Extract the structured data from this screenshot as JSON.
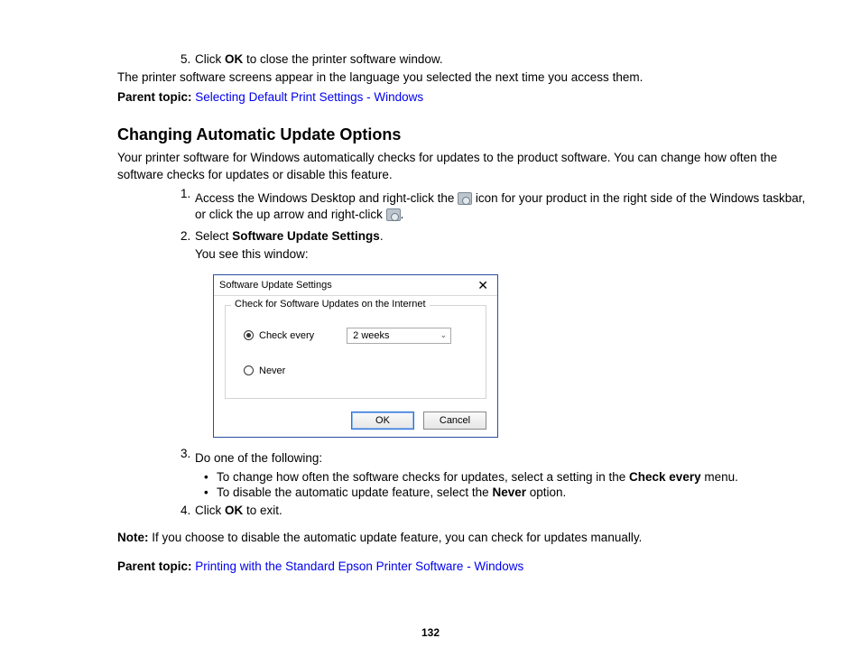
{
  "step5": {
    "num": "5.",
    "text_pre": "Click ",
    "text_bold": "OK",
    "text_post": " to close the printer software window."
  },
  "after5": "The printer software screens appear in the language you selected the next time you access them.",
  "parent1_label": "Parent topic:",
  "parent1_link": "Selecting Default Print Settings - Windows",
  "heading": "Changing Automatic Update Options",
  "intro": "Your printer software for Windows automatically checks for updates to the product software. You can change how often the software checks for updates or disable this feature.",
  "step1": {
    "num": "1.",
    "pre": "Access the Windows Desktop and right-click the ",
    "mid": " icon for your product in the right side of the Windows taskbar, or click the up arrow and right-click ",
    "post": "."
  },
  "step2": {
    "num": "2.",
    "pre": "Select ",
    "bold": "Software Update Settings",
    "post": ".",
    "yousee": "You see this window:"
  },
  "dialog": {
    "title": "Software Update Settings",
    "legend": "Check for Software Updates on the Internet",
    "radio_check": "Check every",
    "combo_value": "2 weeks",
    "radio_never": "Never",
    "ok": "OK",
    "cancel": "Cancel"
  },
  "step3": {
    "num": "3.",
    "text": "Do one of the following:",
    "bullet1_pre": "To change how often the software checks for updates, select a setting in the ",
    "bullet1_bold": "Check every",
    "bullet1_post": " menu.",
    "bullet2_pre": "To disable the automatic update feature, select the ",
    "bullet2_bold": "Never",
    "bullet2_post": " option."
  },
  "step4": {
    "num": "4.",
    "pre": "Click ",
    "bold": "OK",
    "post": " to exit."
  },
  "note_label": "Note:",
  "note_text": " If you choose to disable the automatic update feature, you can check for updates manually.",
  "parent2_label": "Parent topic:",
  "parent2_link": "Printing with the Standard Epson Printer Software - Windows",
  "page_number": "132"
}
